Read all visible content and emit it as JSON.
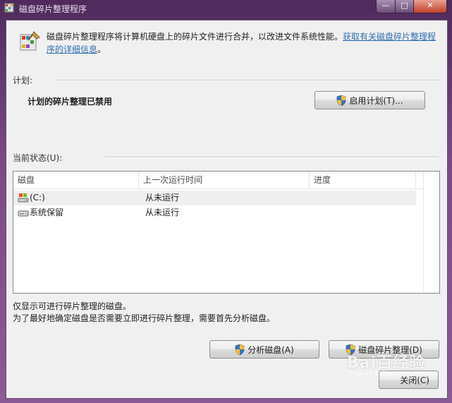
{
  "window": {
    "title": "磁盘碎片整理程序",
    "minimize_glyph": "—",
    "maximize_glyph": "□",
    "close_glyph": "✕"
  },
  "header": {
    "description": "磁盘碎片整理程序将计算机硬盘上的碎片文件进行合并，以改进文件系统性能。",
    "link_text": "获取有关磁盘碎片整理程序的详细信息",
    "link_suffix": "。"
  },
  "schedule": {
    "label": "计划:",
    "status": "计划的碎片整理已禁用",
    "enable_button": "启用计划(T)..."
  },
  "current_status": {
    "label": "当前状态(U):",
    "columns": [
      "磁盘",
      "上一次运行时间",
      "进度"
    ],
    "rows": [
      {
        "disk": "(C:)",
        "last_run": "从未运行",
        "progress": "",
        "icon": "system-drive-icon"
      },
      {
        "disk": "系统保留",
        "last_run": "从未运行",
        "progress": "",
        "icon": "drive-icon"
      }
    ]
  },
  "notes": {
    "line1": "仅显示可进行碎片整理的磁盘。",
    "line2": "为了最好地确定磁盘是否需要立即进行碎片整理，需要首先分析磁盘。"
  },
  "actions": {
    "analyze": "分析磁盘(A)",
    "defragment": "磁盘碎片整理(D)",
    "close": "关闭(C)"
  },
  "watermark": {
    "text": "Bai百经验",
    "sub": "jingyan.baidu.com"
  },
  "colors": {
    "frame": "#6b3f7a",
    "link": "#2f6fb0",
    "client_bg": "#f0f0f0"
  }
}
